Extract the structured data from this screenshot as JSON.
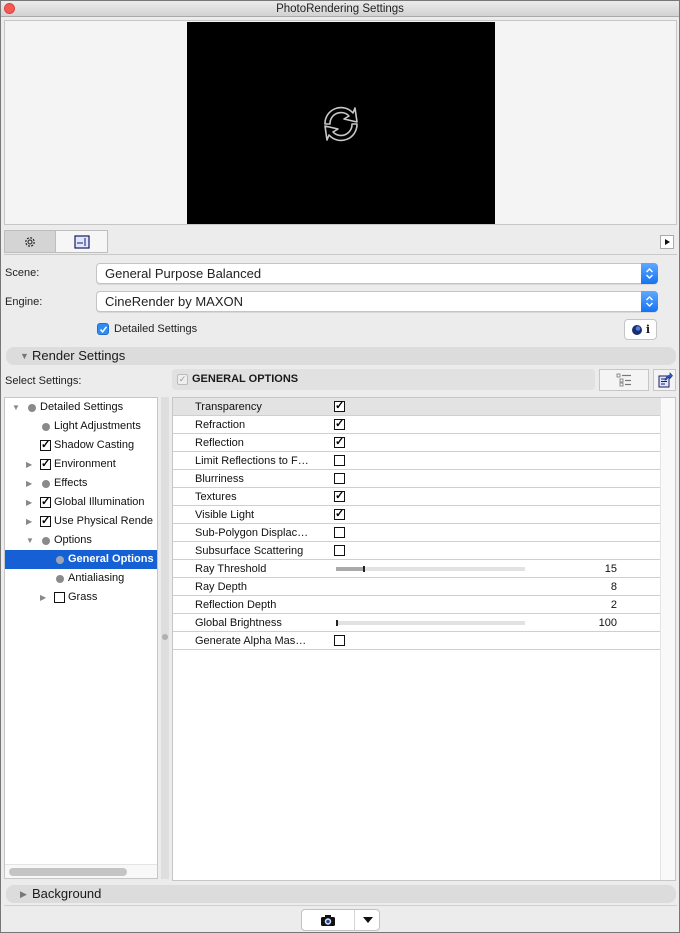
{
  "window": {
    "title": "PhotoRendering Settings"
  },
  "preview": {
    "icon": "refresh-icon"
  },
  "view_tabs": [
    {
      "icon": "gear-icon",
      "active": true
    },
    {
      "icon": "dimension-frame-icon",
      "active": false
    }
  ],
  "form": {
    "scene_label": "Scene:",
    "scene_value": "General Purpose Balanced",
    "engine_label": "Engine:",
    "engine_value": "CineRender by MAXON",
    "detailed_settings_label": "Detailed Settings",
    "detailed_settings_checked": true,
    "engine_info_icon": "cinema4d-info-icon",
    "info_glyph": "i"
  },
  "render_settings": {
    "title": "Render Settings",
    "expanded": true,
    "select_label": "Select Settings:",
    "panel_title": "GENERAL OPTIONS",
    "panel_check": "✓"
  },
  "tree": [
    {
      "label": "Detailed Settings",
      "level": 0,
      "arrow": "down",
      "marker": "disc"
    },
    {
      "label": "Light Adjustments",
      "level": 1,
      "arrow": "",
      "marker": "disc"
    },
    {
      "label": "Shadow Casting",
      "level": 1,
      "arrow": "",
      "marker": "checked"
    },
    {
      "label": "Environment",
      "level": 1,
      "arrow": "right",
      "marker": "checked"
    },
    {
      "label": "Effects",
      "level": 1,
      "arrow": "right",
      "marker": "disc"
    },
    {
      "label": "Global Illumination",
      "level": 1,
      "arrow": "right",
      "marker": "checked"
    },
    {
      "label": "Use Physical Rende",
      "level": 1,
      "arrow": "right",
      "marker": "checked"
    },
    {
      "label": "Options",
      "level": 1,
      "arrow": "down",
      "marker": "disc"
    },
    {
      "label": "General Options",
      "level": 2,
      "arrow": "",
      "marker": "disc",
      "selected": true
    },
    {
      "label": "Antialiasing",
      "level": 2,
      "arrow": "",
      "marker": "disc"
    },
    {
      "label": "Grass",
      "level": 2,
      "arrow": "right",
      "marker": "unchecked"
    }
  ],
  "options": [
    {
      "name": "Transparency",
      "type": "checkbox",
      "checked": true
    },
    {
      "name": "Refraction",
      "type": "checkbox",
      "checked": true
    },
    {
      "name": "Reflection",
      "type": "checkbox",
      "checked": true
    },
    {
      "name": "Limit Reflections to F…",
      "type": "checkbox",
      "checked": false
    },
    {
      "name": "Blurriness",
      "type": "checkbox",
      "checked": false
    },
    {
      "name": "Textures",
      "type": "checkbox",
      "checked": true
    },
    {
      "name": "Visible Light",
      "type": "checkbox",
      "checked": true
    },
    {
      "name": "Sub-Polygon Displac…",
      "type": "checkbox",
      "checked": false
    },
    {
      "name": "Subsurface Scattering",
      "type": "checkbox",
      "checked": false
    },
    {
      "name": "Ray Threshold",
      "type": "slider",
      "value": "15",
      "fraction": 0.15
    },
    {
      "name": "Ray Depth",
      "type": "number",
      "value": "8"
    },
    {
      "name": "Reflection Depth",
      "type": "number",
      "value": "2"
    },
    {
      "name": "Global Brightness",
      "type": "slider",
      "value": "100",
      "fraction": 0.0
    },
    {
      "name": "Generate Alpha Mas…",
      "type": "checkbox",
      "checked": false
    }
  ],
  "background_section": {
    "title": "Background",
    "expanded": false
  },
  "footer": {
    "render_button_icon": "camera-icon",
    "menu_icon": "dropdown-arrow-icon"
  },
  "check_glyph": "✓"
}
